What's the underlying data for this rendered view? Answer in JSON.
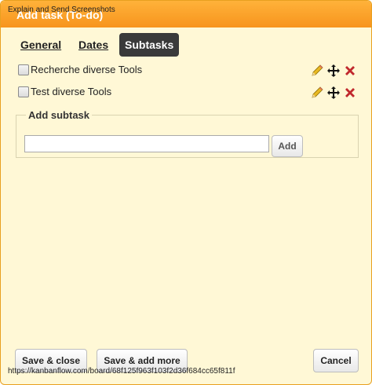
{
  "overlay_caption": "Explain and Send Screenshots",
  "dialog": {
    "title": "Add task (To-do)"
  },
  "tabs": [
    {
      "label": "General",
      "active": false
    },
    {
      "label": "Dates",
      "active": false
    },
    {
      "label": "Subtasks",
      "active": true
    }
  ],
  "subtasks": [
    {
      "label": "Recherche diverse Tools",
      "checked": false,
      "icons": [
        "pencil-icon",
        "move-icon",
        "delete-icon"
      ]
    },
    {
      "label": "Test diverse Tools",
      "checked": false,
      "icons": [
        "pencil-icon",
        "move-icon",
        "delete-icon"
      ]
    }
  ],
  "add_subtask": {
    "legend": "Add subtask",
    "input_value": "",
    "button_label": "Add"
  },
  "footer": {
    "save_close_label": "Save & close",
    "save_add_more_label": "Save & add more",
    "cancel_label": "Cancel"
  },
  "status_url": "https://kanbanflow.com/board/68f125f963f103f2d36f684cc65f811f",
  "colors": {
    "title_bar": "#f7941d",
    "dialog_background": "#fff8d6",
    "active_tab": "#3a3a3a",
    "delete_icon": "#c0282d"
  }
}
